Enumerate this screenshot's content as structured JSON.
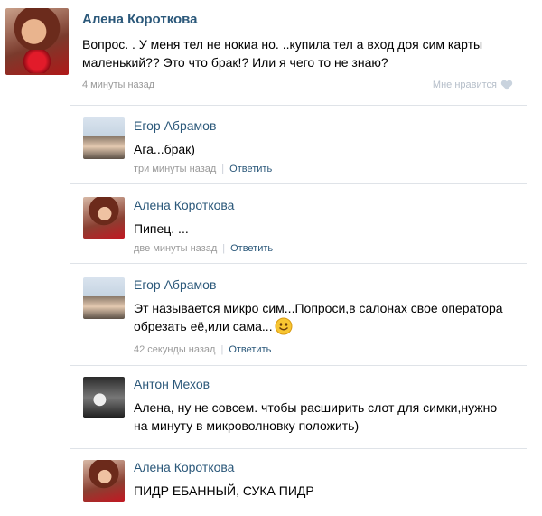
{
  "post": {
    "author": "Алена Короткова",
    "text": "Вопрос. . У меня тел не нокиа но. ..купила тел а вход доя сим карты маленький?? Это что брак!? Или я чего то не знаю?",
    "time": "4 минуты назад",
    "like_label": "Мне нравится",
    "like_icon": "heart-icon"
  },
  "comments": [
    {
      "author": "Егор Абрамов",
      "text": "Ага...брак)",
      "time": "три минуты назад",
      "reply_label": "Ответить"
    },
    {
      "author": "Алена Короткова",
      "text": "Пипец. ...",
      "time": "две минуты назад",
      "reply_label": "Ответить"
    },
    {
      "author": "Егор Абрамов",
      "text": "Эт называется микро сим...Попроси,в салонах свое оператора обрезать её,или сама...",
      "emoji": "smiley-icon",
      "time": "42 секунды назад",
      "reply_label": "Ответить"
    },
    {
      "author": "Антон Мехов",
      "text": "Алена, ну не совсем. чтобы расширить слот для симки,нужно на минуту в микроволновку положить)"
    },
    {
      "author": "Алена Короткова",
      "text": "ПИДР ЕБАННЫЙ, СУКА ПИДР"
    }
  ],
  "colors": {
    "link": "#2b587a",
    "meta": "#999999",
    "divider": "#dfe3e8"
  }
}
